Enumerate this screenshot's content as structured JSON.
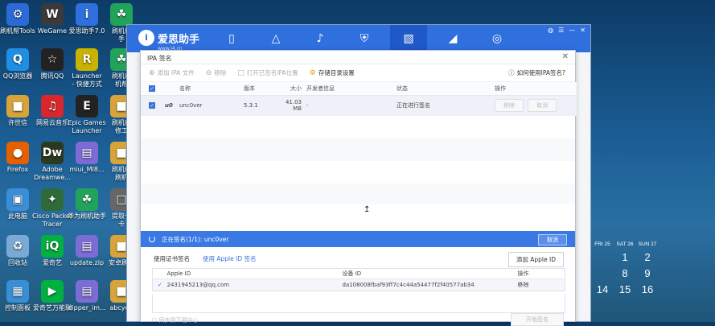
{
  "desktop_icons": [
    {
      "id": "tools",
      "label": "刷机帮Tools",
      "glyph": "⚙",
      "color": "#2d6ad6"
    },
    {
      "id": "wegame",
      "label": "WeGame",
      "glyph": "W",
      "color": "#3a3a3a"
    },
    {
      "id": "aisi",
      "label": "爱思助手7.0",
      "glyph": "i",
      "color": "#2f6fde"
    },
    {
      "id": "shuajibang1",
      "label": "刷机帮\n手",
      "glyph": "☘",
      "color": "#22a35a"
    },
    {
      "id": "qqbrowser",
      "label": "QQ浏览器",
      "glyph": "Q",
      "color": "#1f8fe6"
    },
    {
      "id": "tencentqq",
      "label": "腾讯QQ",
      "glyph": "☆",
      "color": "#222"
    },
    {
      "id": "launcher",
      "label": "Launcher\n- 快捷方式",
      "glyph": "R",
      "color": "#c9b200"
    },
    {
      "id": "shuajibang2",
      "label": "刷机帮\n机帮",
      "glyph": "☘",
      "color": "#22a35a"
    },
    {
      "id": "xushixin",
      "label": "许世信",
      "glyph": "■",
      "color": "#d6a43a"
    },
    {
      "id": "netease",
      "label": "网易云音乐",
      "glyph": "♫",
      "color": "#d8262d"
    },
    {
      "id": "epic",
      "label": "Epic Games\nLauncher",
      "glyph": "E",
      "color": "#222"
    },
    {
      "id": "xiugong",
      "label": "刷机帮\n修工",
      "glyph": "■",
      "color": "#d6a43a"
    },
    {
      "id": "firefox",
      "label": "Firefox",
      "glyph": "●",
      "color": "#e66000"
    },
    {
      "id": "dreamweaver",
      "label": "Adobe\nDreamwe...",
      "glyph": "Dw",
      "color": "#2b3a1e"
    },
    {
      "id": "miui",
      "label": "miui_MI8...",
      "glyph": "▤",
      "color": "#7d6bd6"
    },
    {
      "id": "shuajibang3",
      "label": "刷机帮\n刷机",
      "glyph": "■",
      "color": "#d6a43a"
    },
    {
      "id": "thispc",
      "label": "此电脑",
      "glyph": "▣",
      "color": "#3a8ed6"
    },
    {
      "id": "cisco",
      "label": "Cisco Packet\nTracer",
      "glyph": "✦",
      "color": "#2e6a3a"
    },
    {
      "id": "huaweishua",
      "label": "华为刷机助手",
      "glyph": "☘",
      "color": "#22a35a"
    },
    {
      "id": "tixing",
      "label": "提取卡\n卡",
      "glyph": "□",
      "color": "#666"
    },
    {
      "id": "recycle",
      "label": "回收站",
      "glyph": "♻",
      "color": "#7aa9d6"
    },
    {
      "id": "iqiyi",
      "label": "爱奇艺",
      "glyph": "iQ",
      "color": "#00b140"
    },
    {
      "id": "updatezip",
      "label": "update.zip",
      "glyph": "▤",
      "color": "#7d6bd6"
    },
    {
      "id": "anzhuo",
      "label": "安卓刷机",
      "glyph": "■",
      "color": "#d6a43a"
    },
    {
      "id": "control",
      "label": "控制面板",
      "glyph": "▦",
      "color": "#3a8ed6"
    },
    {
      "id": "iqiyi-wanneng",
      "label": "爱奇艺万能联",
      "glyph": "▶",
      "color": "#00b140"
    },
    {
      "id": "dipper",
      "label": "dipper_im...",
      "glyph": "▤",
      "color": "#7d6bd6"
    },
    {
      "id": "abcyd",
      "label": "abcydn",
      "glyph": "■",
      "color": "#d6a43a"
    }
  ],
  "app": {
    "brand": "爱思助手",
    "brand_sub": "www.i4.cn",
    "tab_icons": [
      "phone-icon",
      "appstore-icon",
      "ringtone-icon",
      "shield-icon",
      "toolbox-icon",
      "graduation-icon",
      "compass-icon"
    ],
    "tab_glyphs": [
      "▯",
      "△",
      "♪",
      "⛨",
      "▧",
      "◢",
      "◎"
    ]
  },
  "dialog": {
    "title": "IPA 签名",
    "toolbar": {
      "add_ipa": "添加 IPA 文件",
      "remove": "移除",
      "open_folder": "打开已签名IPA位置",
      "save_dir": "存储目录设置",
      "help": "如何使用IPA签名?"
    },
    "columns": {
      "name": "名称",
      "version": "版本",
      "size": "大小",
      "developer": "开发者信息",
      "status": "状态",
      "action": "操作"
    },
    "files": [
      {
        "icon": "u0",
        "name": "unc0ver",
        "version": "5.3.1",
        "size": "41.03 MB",
        "developer": "-",
        "status": "正在进行签名",
        "btn_remove": "移除",
        "btn_cancel": "取消"
      }
    ],
    "status_bar": {
      "text": "正在签名(1/1): unc0ver",
      "cancel": "取消"
    },
    "cert_tabs": {
      "tab1": "使用证书签名",
      "tab2": "使用 Apple ID 签名"
    },
    "add_appleid": "添加 Apple ID",
    "acct_columns": {
      "appleid": "Apple ID",
      "device_id": "设备 ID",
      "action": "操作"
    },
    "accounts": [
      {
        "appleid": "2431945213@qq.com",
        "device_id": "da108008fbaf93ff7c4c44a54477f2f40577ab34",
        "action": "移除"
      }
    ],
    "bottom_check": "同步到下载中心",
    "bottom_btn": "开始签名"
  },
  "calendar": {
    "headers": [
      "FRI 25",
      "SAT 26",
      "SUN 27"
    ],
    "rows": [
      [
        "1",
        "2"
      ],
      [
        "8",
        "9"
      ],
      [
        "14",
        "15",
        "16"
      ]
    ]
  }
}
